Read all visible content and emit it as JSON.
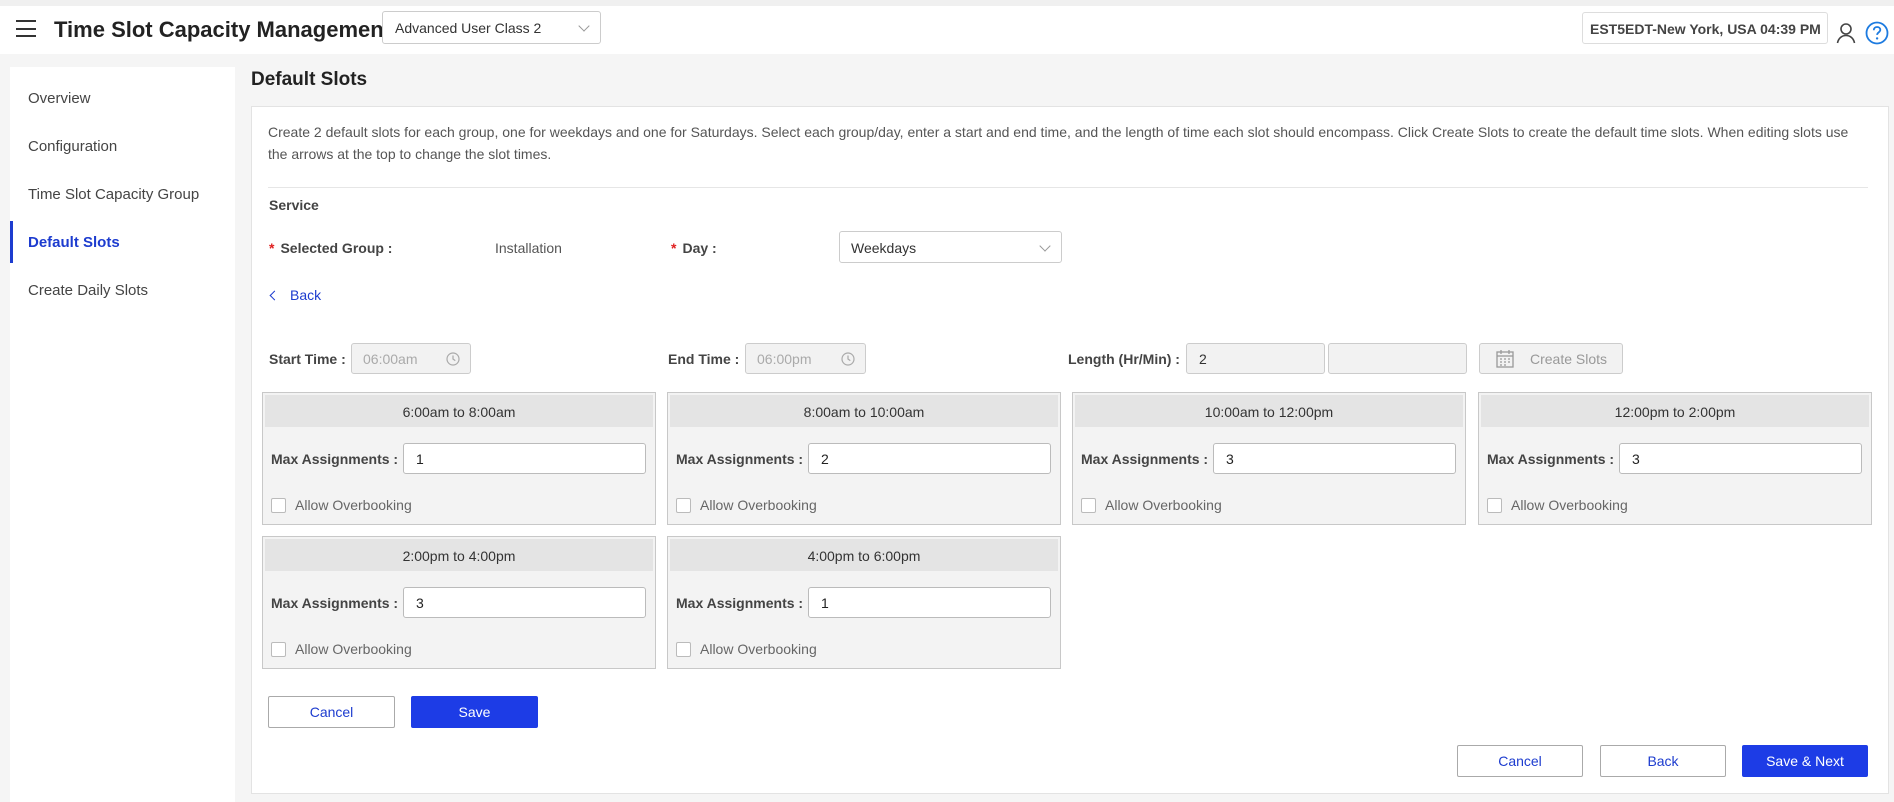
{
  "header": {
    "title": "Time Slot Capacity Management",
    "user_class": "Advanced User Class 2",
    "timezone": "EST5EDT-New York, USA 04:39 PM"
  },
  "sidebar": {
    "items": [
      {
        "label": "Overview",
        "active": false
      },
      {
        "label": "Configuration",
        "active": false
      },
      {
        "label": "Time Slot Capacity Group",
        "active": false
      },
      {
        "label": "Default Slots",
        "active": true
      },
      {
        "label": "Create Daily Slots",
        "active": false
      }
    ]
  },
  "page": {
    "title": "Default Slots",
    "description": "Create 2 default slots for each group, one for weekdays and one for Saturdays. Select each group/day, enter a start and end time, and the length of time each slot should encompass. Click Create Slots to create the default time slots. When editing slots use the arrows at the top to change the slot times.",
    "section": "Service",
    "selected_group_label": "Selected Group :",
    "selected_group_value": "Installation",
    "day_label": "Day :",
    "day_value": "Weekdays",
    "back_link": "Back"
  },
  "time_settings": {
    "start_label": "Start Time :",
    "start_value": "06:00am",
    "end_label": "End Time :",
    "end_value": "06:00pm",
    "length_label": "Length (Hr/Min) :",
    "length_hours": "2",
    "length_minutes": "",
    "create_slots_label": "Create Slots"
  },
  "slots": [
    {
      "range": "6:00am to 8:00am",
      "max_assignments": "1",
      "allow_overbooking": false
    },
    {
      "range": "8:00am to 10:00am",
      "max_assignments": "2",
      "allow_overbooking": false
    },
    {
      "range": "10:00am to 12:00pm",
      "max_assignments": "3",
      "allow_overbooking": false
    },
    {
      "range": "12:00pm to 2:00pm",
      "max_assignments": "3",
      "allow_overbooking": false
    },
    {
      "range": "2:00pm to 4:00pm",
      "max_assignments": "3",
      "allow_overbooking": false
    },
    {
      "range": "4:00pm to 6:00pm",
      "max_assignments": "1",
      "allow_overbooking": false
    }
  ],
  "slot_labels": {
    "max_assignments": "Max Assignments :",
    "allow_overbooking": "Allow Overbooking"
  },
  "actions": {
    "cancel": "Cancel",
    "save": "Save",
    "footer_cancel": "Cancel",
    "footer_back": "Back",
    "footer_save_next": "Save & Next"
  },
  "colors": {
    "accent": "#1d3ce6",
    "link": "#1d3ccf",
    "required": "#e02020"
  }
}
